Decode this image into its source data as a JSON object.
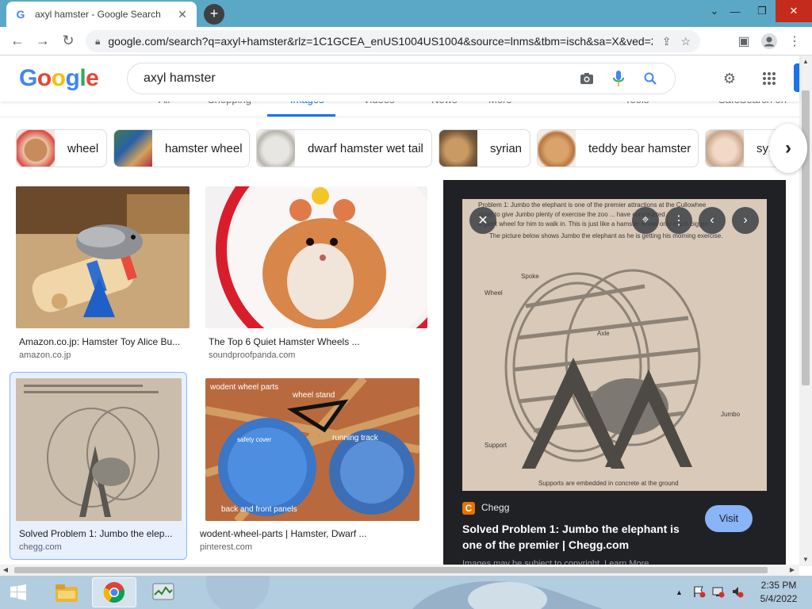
{
  "browser": {
    "tab_title": "axyl hamster - Google Search",
    "tab_favicon": "G",
    "url": "google.com/search?q=axyl+hamster&rlz=1C1GCEA_enUS1004US1004&source=lnms&tbm=isch&sa=X&ved=2a...",
    "new_tab_label": "+"
  },
  "google": {
    "logo": [
      "G",
      "o",
      "o",
      "g",
      "l",
      "e"
    ],
    "logo_colors": [
      "#4285f4",
      "#ea4335",
      "#fbbc05",
      "#4285f4",
      "#34a853",
      "#ea4335"
    ],
    "query": "axyl hamster",
    "tabs": [
      "All",
      "Shopping",
      "Images",
      "Videos",
      "News",
      "More",
      "Tools",
      "SafeSearch on"
    ],
    "accent": "#1a73e8"
  },
  "chips": [
    "wheel",
    "hamster wheel",
    "dwarf hamster wet tail",
    "syrian",
    "teddy bear hamster",
    "syri"
  ],
  "results": [
    {
      "title": "Amazon.co.jp: Hamster Toy Alice Bu...",
      "source": "amazon.co.jp"
    },
    {
      "title": "The Top 6 Quiet Hamster Wheels ...",
      "source": "soundproofpanda.com"
    },
    {
      "title": "Solved Problem 1: Jumbo the elep...",
      "source": "chegg.com"
    },
    {
      "title": "wodent-wheel-parts | Hamster, Dwarf ...",
      "source": "pinterest.com"
    }
  ],
  "preview": {
    "site": "Chegg",
    "site_logo": "C",
    "title": "Solved Problem 1: Jumbo the elephant is one of the premier | Chegg.com",
    "visit_label": "Visit",
    "copyright": "Images may be subject to copyright. Learn More",
    "image_text": {
      "problem": "Problem 1:  Jumbo the elephant is one of the premier attractions at the Cullowhee",
      "line2": "order to give Jumbo plenty of exercise the zoo ... have constructed",
      "line3": "a giant wheel for him to walk in.  This is just like a hamster wheel only much bigger.",
      "line4": "The picture below shows Jumbo the elephant as he is getting his morning exercise.",
      "spoke": "Spoke",
      "wheel": "Wheel",
      "axle": "Axle",
      "jumbo": "Jumbo",
      "support": "Support",
      "footer": "Supports are embedded in concrete at the ground"
    },
    "parts_image_text": {
      "title": "wodent wheel parts",
      "stand": "wheel stand",
      "track": "running track",
      "cover": "safety cover",
      "panels": "back and front panels"
    }
  },
  "taskbar": {
    "time": "2:35 PM",
    "date": "5/4/2022",
    "tray_arrow": "▲"
  }
}
